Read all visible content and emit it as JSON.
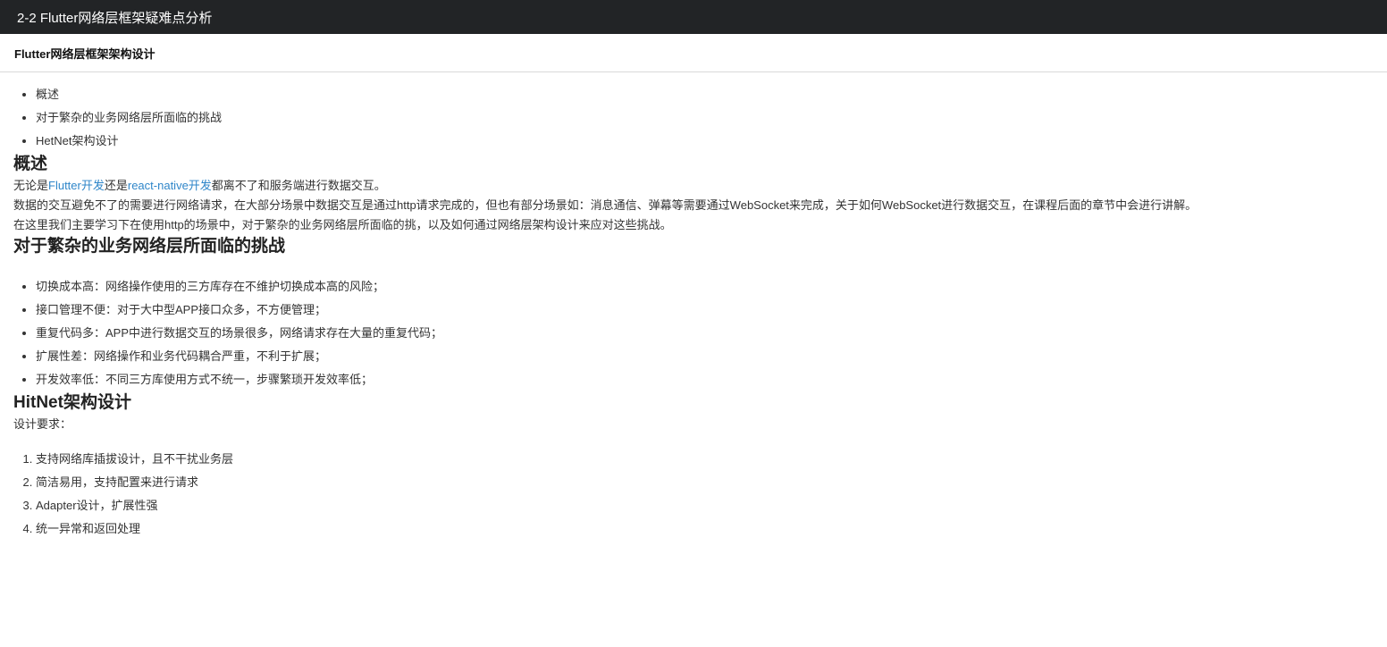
{
  "header": {
    "title": "2-2 Flutter网络层框架疑难点分析"
  },
  "subheader": {
    "title": "Flutter网络层框架架构设计"
  },
  "toc": [
    "概述",
    "对于繁杂的业务网络层所面临的挑战",
    "HetNet架构设计"
  ],
  "sections": {
    "overview": {
      "heading": "概述",
      "p1_prefix": "无论是",
      "p1_link1": "Flutter开发",
      "p1_mid": "还是",
      "p1_link2": "react-native开发",
      "p1_suffix": "都离不了和服务端进行数据交互。",
      "p2_line1": "数据的交互避免不了的需要进行网络请求，在大部分场景中数据交互是通过http请求完成的，但也有部分场景如：消息通信、弹幕等需要通过WebSocket来完成，关于如何WebSocket进行数据交互，在课程后面的章节中会进行讲解。",
      "p2_line2": "在这里我们主要学习下在使用http的场景中，对于繁杂的业务网络层所面临的挑，以及如何通过网络层架构设计来应对这些挑战。"
    },
    "challenges": {
      "heading": "对于繁杂的业务网络层所面临的挑战",
      "items": [
        "切换成本高：网络操作使用的三方库存在不维护切换成本高的风险；",
        "接口管理不便：对于大中型APP接口众多，不方便管理；",
        "重复代码多：APP中进行数据交互的场景很多，网络请求存在大量的重复代码；",
        "扩展性差：网络操作和业务代码耦合严重，不利于扩展；",
        "开发效率低：不同三方库使用方式不统一，步骤繁琐开发效率低；"
      ]
    },
    "design": {
      "heading": "HitNet架构设计",
      "intro": "设计要求：",
      "steps": [
        "支持网络库插拔设计，且不干扰业务层",
        "简洁易用，支持配置来进行请求",
        "Adapter设计，扩展性强",
        "统一异常和返回处理"
      ]
    }
  },
  "colors": {
    "header_bg": "#222426",
    "link": "#2f86c9"
  }
}
